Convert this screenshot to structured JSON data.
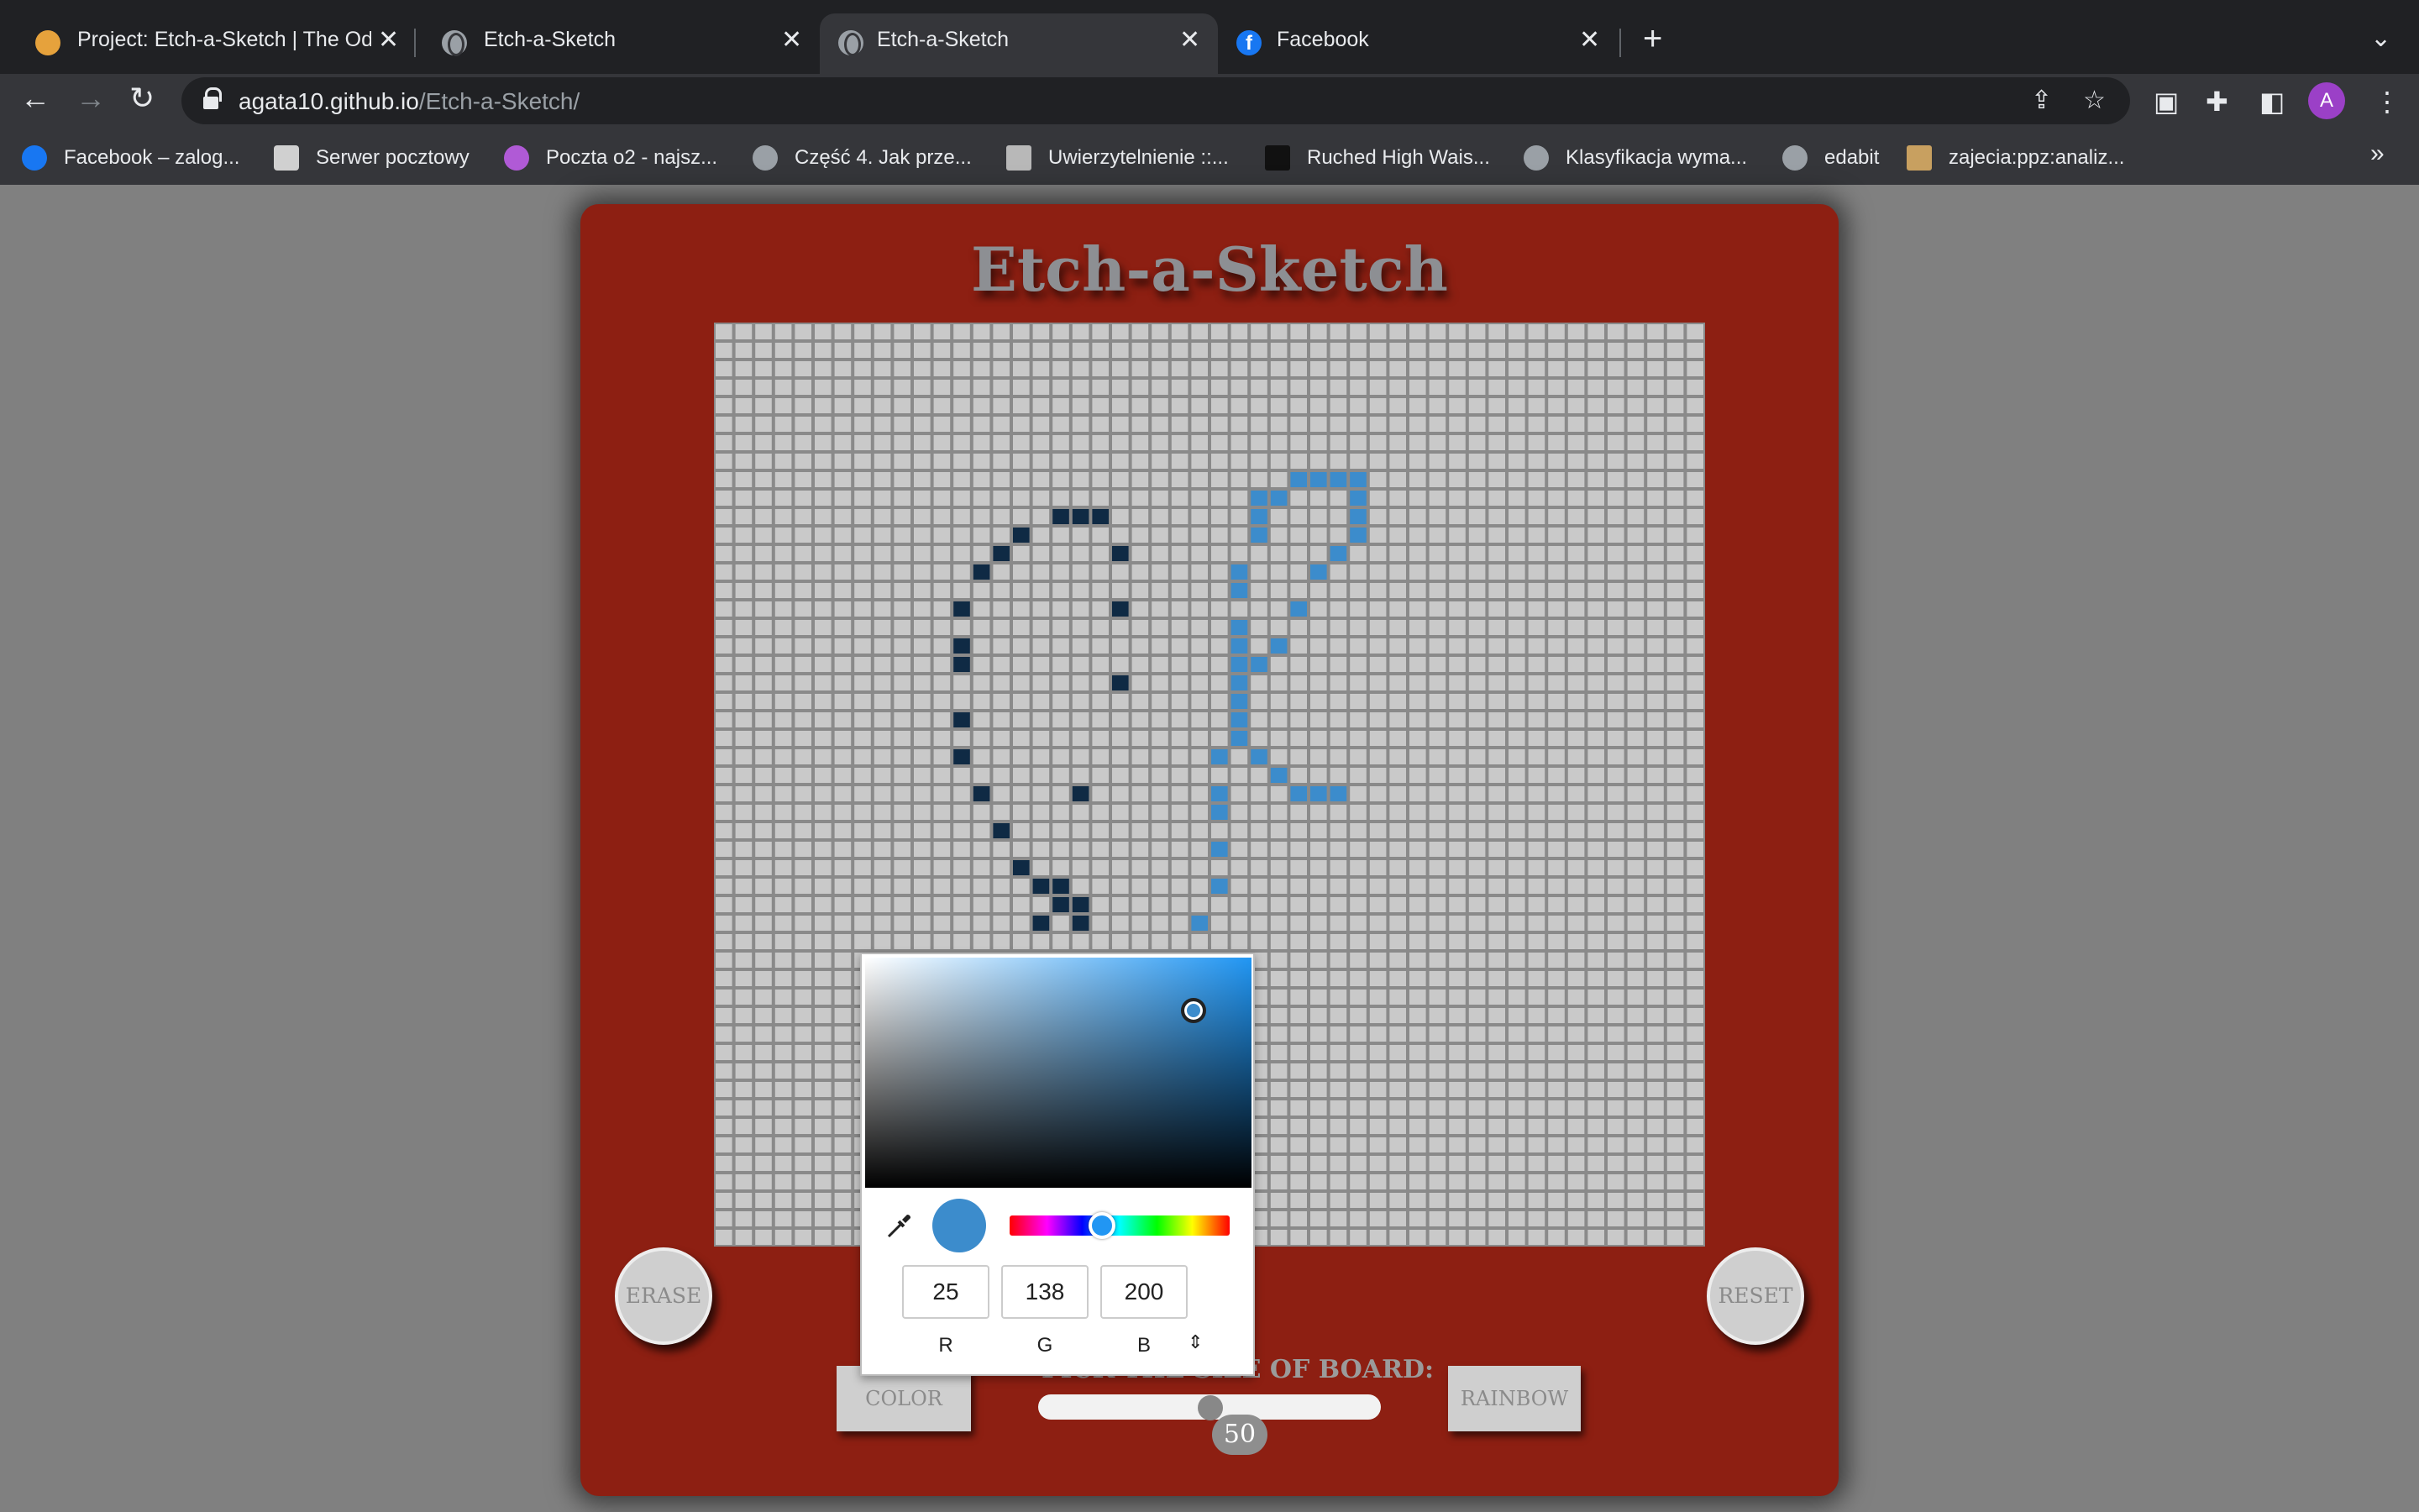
{
  "browser": {
    "tabs": [
      {
        "title": "Project: Etch-a-Sketch | The Od",
        "favicon": "odin-icon"
      },
      {
        "title": "Etch-a-Sketch",
        "favicon": "globe-icon"
      },
      {
        "title": "Etch-a-Sketch",
        "favicon": "globe-icon",
        "active": true
      },
      {
        "title": "Facebook",
        "favicon": "facebook-icon"
      }
    ],
    "url_host": "agata10.github.io",
    "url_path": "/Etch-a-Sketch/",
    "avatar_letter": "A",
    "bookmarks": [
      "Facebook – zalog...",
      "Serwer pocztowy",
      "Poczta o2 - najsz...",
      "Część 4. Jak prze...",
      "Uwierzytelnienie ::...",
      "Ruched High Wais...",
      "Klasyfikacja wyma...",
      "edabit",
      "zajecia:ppz:analiz..."
    ],
    "bookmark_more": "»"
  },
  "app": {
    "title": "Etch-a-Sketch",
    "erase_label": "ERASE",
    "reset_label": "RESET",
    "color_label": "COLOR",
    "rainbow_label": "RAINBOW",
    "size_label": "PICK THE SIZE OF BOARD:",
    "board_size": 50,
    "board_size_min": 1,
    "board_size_max": 100,
    "size_value": "50",
    "grid_color": "#c9c9c9",
    "board_color": "#8d1f12",
    "drawn_cells": [
      {
        "color": "#0f2a44",
        "cells": [
          [
            17,
            10
          ],
          [
            18,
            10
          ],
          [
            19,
            10
          ],
          [
            15,
            11
          ],
          [
            14,
            12
          ],
          [
            20,
            12
          ],
          [
            13,
            13
          ],
          [
            12,
            15
          ],
          [
            20,
            15
          ],
          [
            12,
            17
          ],
          [
            12,
            18
          ],
          [
            20,
            19
          ],
          [
            12,
            21
          ],
          [
            12,
            23
          ],
          [
            13,
            25
          ],
          [
            18,
            25
          ],
          [
            14,
            27
          ],
          [
            15,
            29
          ],
          [
            16,
            30
          ],
          [
            17,
            30
          ],
          [
            17,
            31
          ],
          [
            18,
            31
          ],
          [
            16,
            32
          ],
          [
            18,
            32
          ]
        ]
      },
      {
        "color": "#3c8ccc",
        "cells": [
          [
            29,
            8
          ],
          [
            30,
            8
          ],
          [
            31,
            8
          ],
          [
            32,
            8
          ],
          [
            27,
            9
          ],
          [
            28,
            9
          ],
          [
            32,
            9
          ],
          [
            27,
            10
          ],
          [
            32,
            10
          ],
          [
            27,
            11
          ],
          [
            32,
            11
          ],
          [
            31,
            12
          ],
          [
            26,
            13
          ],
          [
            30,
            13
          ],
          [
            26,
            14
          ],
          [
            29,
            15
          ],
          [
            26,
            16
          ],
          [
            26,
            17
          ],
          [
            28,
            17
          ],
          [
            26,
            18
          ],
          [
            27,
            18
          ],
          [
            26,
            19
          ],
          [
            26,
            20
          ],
          [
            26,
            21
          ],
          [
            26,
            22
          ],
          [
            25,
            23
          ],
          [
            27,
            23
          ],
          [
            28,
            24
          ],
          [
            25,
            25
          ],
          [
            29,
            25
          ],
          [
            30,
            25
          ],
          [
            31,
            25
          ],
          [
            25,
            26
          ],
          [
            25,
            28
          ],
          [
            25,
            30
          ],
          [
            24,
            32
          ]
        ]
      }
    ]
  },
  "color_picker": {
    "r": "25",
    "g": "138",
    "b": "200",
    "r_label": "R",
    "g_label": "G",
    "b_label": "B",
    "current_color": "#198ac8",
    "swatch_color": "#3c8ccc"
  }
}
